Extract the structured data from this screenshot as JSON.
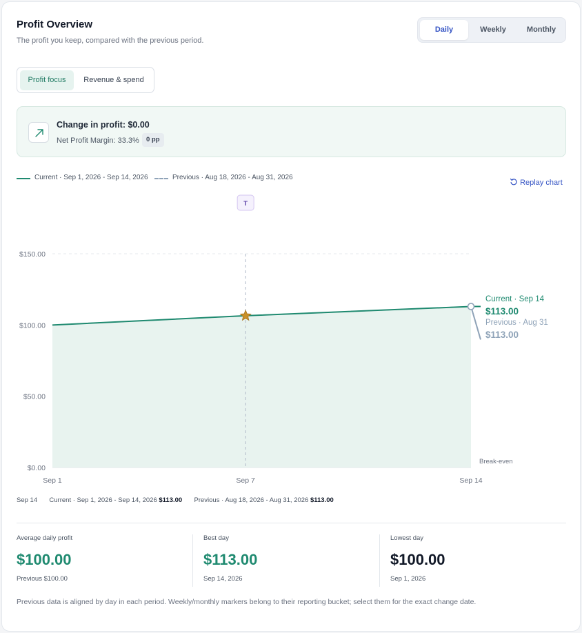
{
  "header": {
    "title": "Profit Overview",
    "subtitle": "The profit you keep, compared with the previous period."
  },
  "period_toggle": {
    "options": [
      "Daily",
      "Weekly",
      "Monthly"
    ],
    "selected": "Daily"
  },
  "focus_toggle": {
    "options": [
      "Profit focus",
      "Revenue & spend"
    ],
    "selected": "Profit focus"
  },
  "change_panel": {
    "title": "Change in profit: $0.00",
    "margin": "Net Profit Margin: 33.3%",
    "margin_change": "0 pp"
  },
  "legend": {
    "current": "Current · Sep 1, 2026 - Sep 14, 2026",
    "previous": "Previous · Aug 18, 2026 - Aug 31, 2026"
  },
  "replay_label": "Replay chart",
  "marker_badge": "T",
  "end_labels": {
    "current_label": "Current · Sep 14",
    "current_value": "$113.00",
    "previous_label": "Previous · Aug 31",
    "previous_value": "$113.00"
  },
  "break_even_label": "Break-even",
  "tooltip": {
    "date": "Sep 14",
    "current_label": "Current · Sep 1, 2026 - Sep 14, 2026",
    "current_value": "$113.00",
    "previous_label": "Previous · Aug 18, 2026 - Aug 31, 2026",
    "previous_value": "$113.00"
  },
  "stats": [
    {
      "label": "Average daily profit",
      "value": "$100.00",
      "note": "Previous $100.00"
    },
    {
      "label": "Best day",
      "value": "$113.00",
      "note": "Sep 14, 2026"
    },
    {
      "label": "Lowest day",
      "value": "$100.00",
      "note": "Sep 1, 2026"
    }
  ],
  "footnote": "Previous data is aligned by day in each period. Weekly/monthly markers belong to their reporting bucket; select them for the exact change date.",
  "colors": {
    "current": "#1f8a70",
    "previous": "#8fa3b8",
    "area": "#e8f3ef",
    "accent": "#3554c4",
    "marker": "#c8902a",
    "lowest_value": "#111827"
  },
  "chart_data": {
    "type": "area",
    "x": [
      "Sep 1",
      "Sep 7",
      "Sep 14"
    ],
    "x_ticks": [
      "Sep 1",
      "Sep 7",
      "Sep 14"
    ],
    "ylim": [
      0,
      150
    ],
    "y_ticks": [
      "$0.00",
      "$50.00",
      "$100.00",
      "$150.00"
    ],
    "y_tick_values": [
      0,
      50,
      100,
      150
    ],
    "grid": true,
    "legend_position": "top-left",
    "series": [
      {
        "name": "Current · Sep 1, 2026 - Sep 14, 2026",
        "values": [
          100,
          106.5,
          113
        ]
      },
      {
        "name": "Previous · Aug 18, 2026 - Aug 31, 2026",
        "values": [
          100,
          106.5,
          113
        ]
      }
    ],
    "marker_x": "Sep 7",
    "marker_value": 106.5
  }
}
